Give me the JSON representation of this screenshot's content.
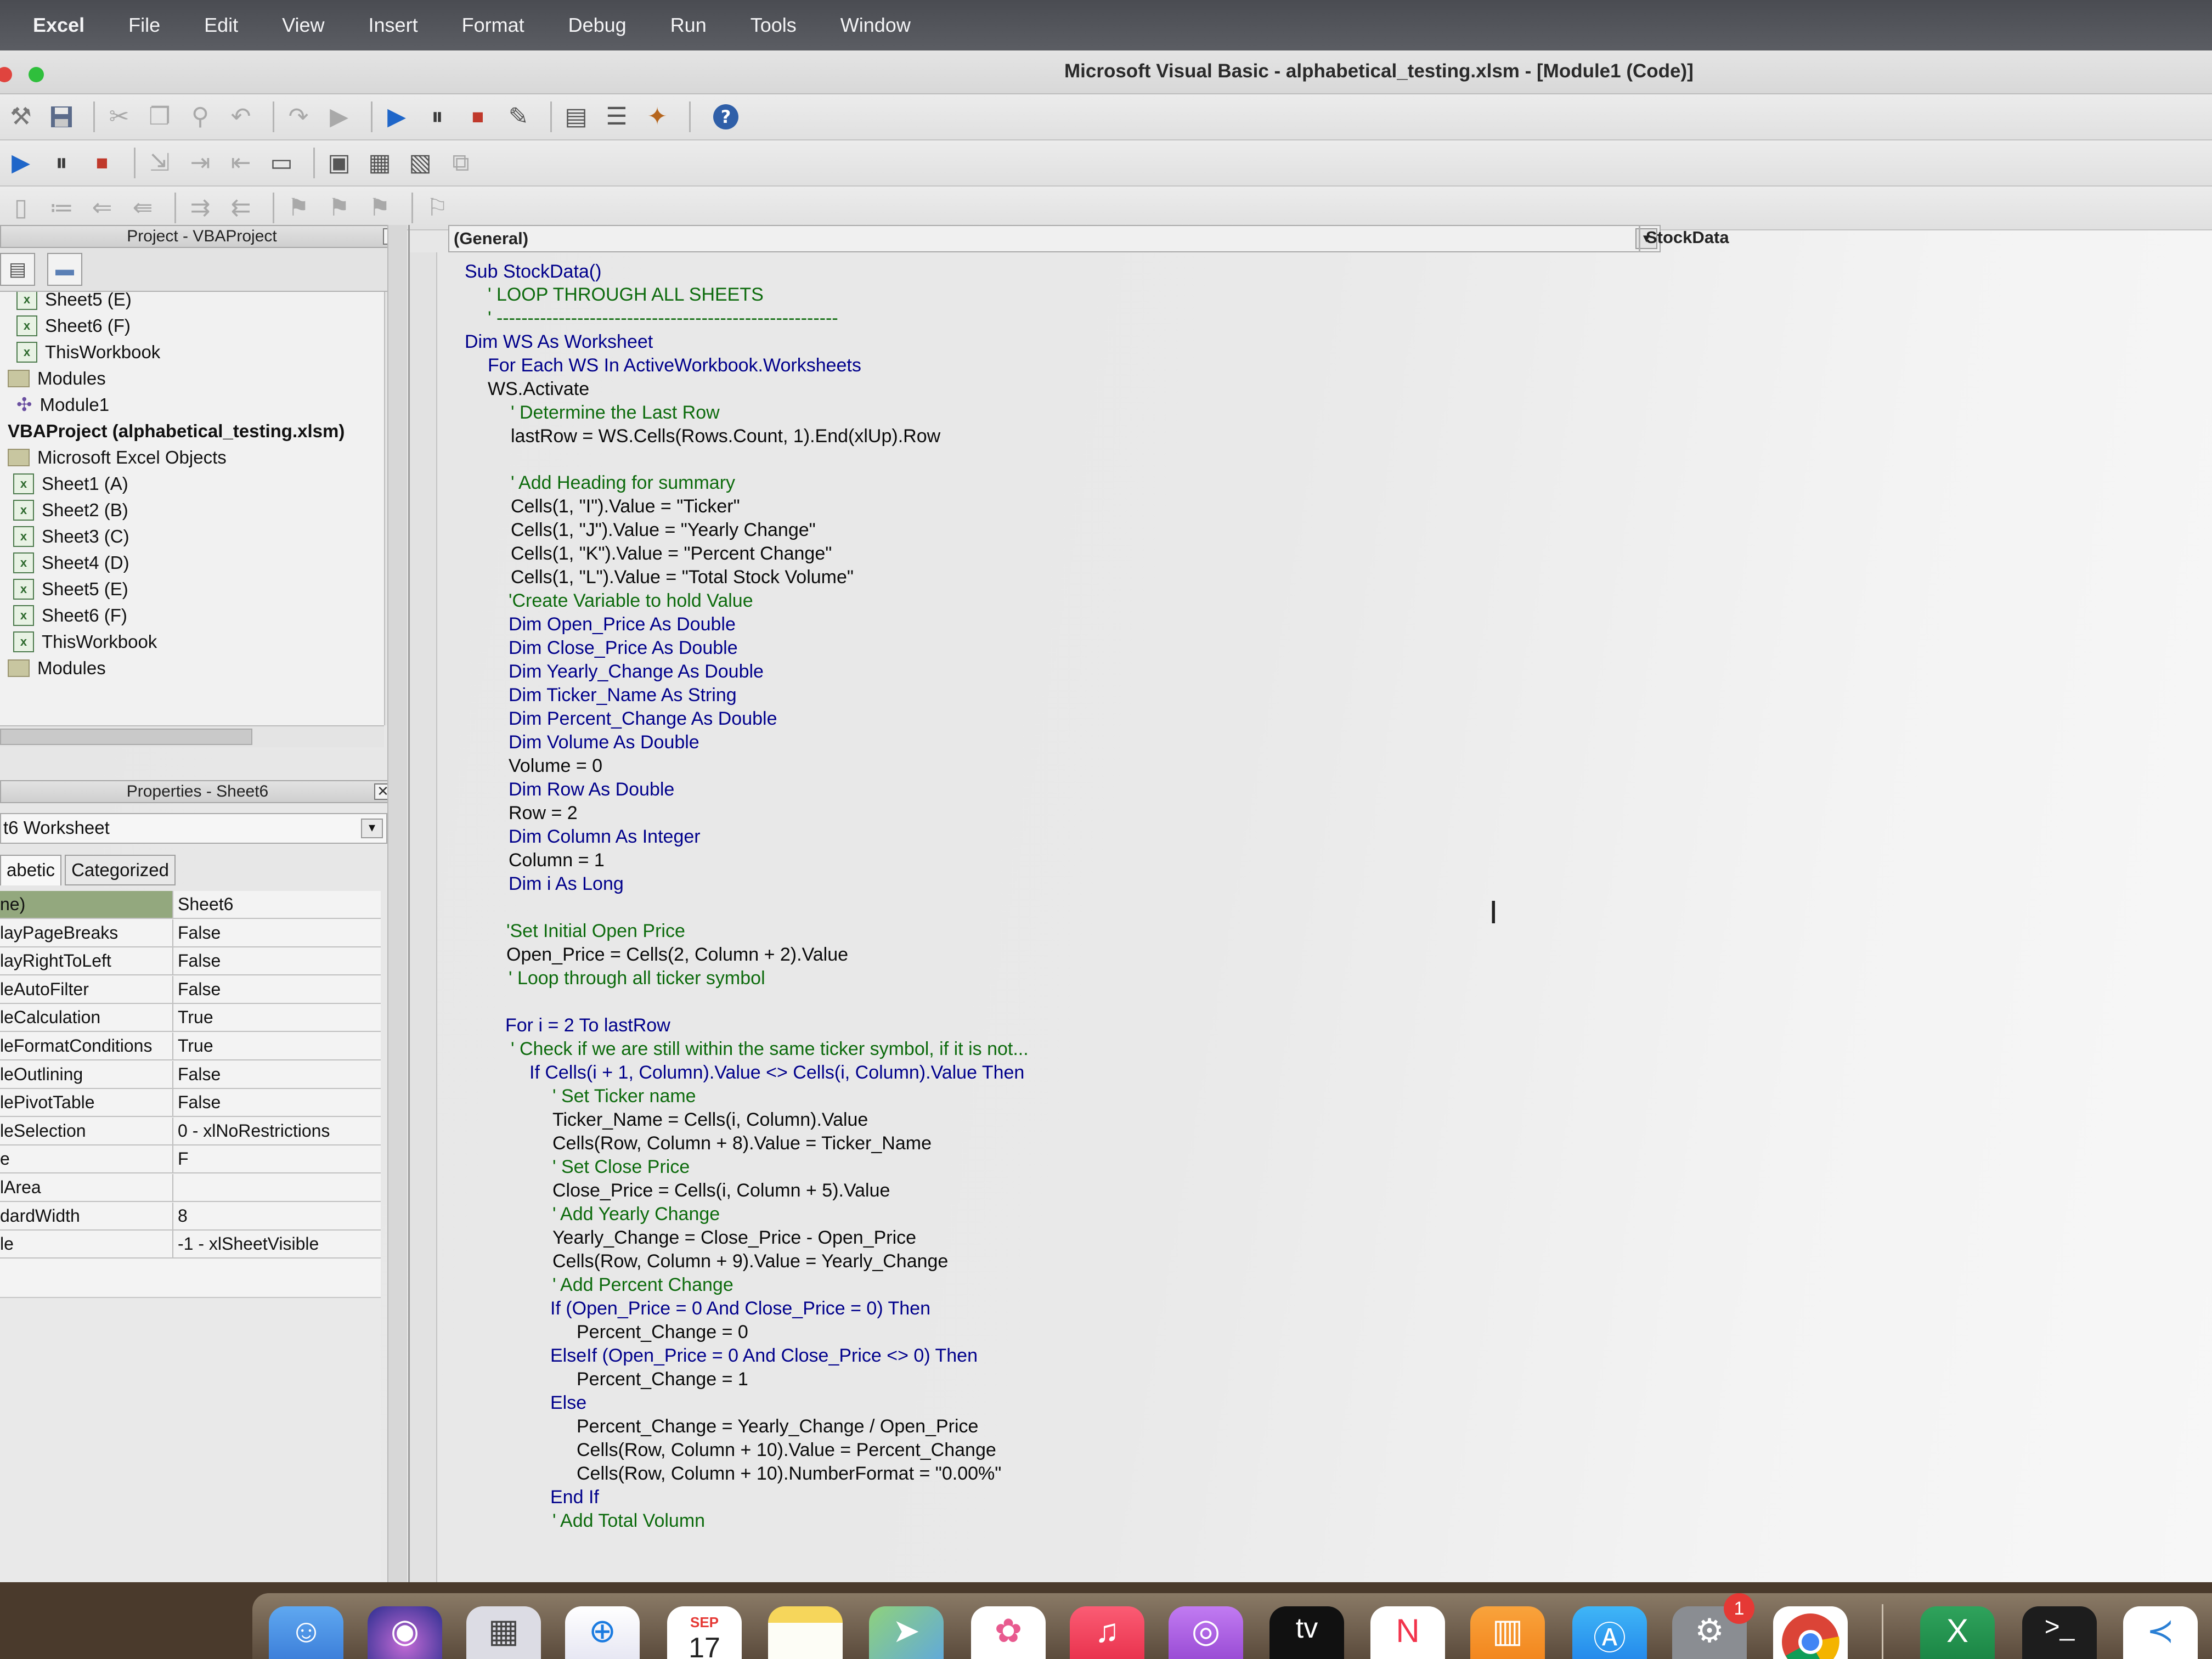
{
  "menubar": {
    "app": "Excel",
    "items": [
      "File",
      "Edit",
      "View",
      "Insert",
      "Format",
      "Debug",
      "Run",
      "Tools",
      "Window"
    ]
  },
  "window": {
    "title": "Microsoft Visual Basic - alphabetical_testing.xlsm - [Module1 (Code)]"
  },
  "toolbar": {
    "icons": [
      "excel-view-icon",
      "save-icon",
      "cut-icon",
      "copy-icon",
      "find-icon",
      "undo-icon",
      "redo-icon",
      "run-icon",
      "break-icon",
      "reset-icon",
      "design-mode-icon",
      "project-explorer-icon",
      "properties-window-icon",
      "object-browser-icon",
      "help-icon"
    ]
  },
  "project": {
    "header": "Project - VBAProject",
    "tree": [
      {
        "label": "Sheet5 (E)",
        "icon": "sheet"
      },
      {
        "label": "Sheet6 (F)",
        "icon": "sheet"
      },
      {
        "label": "ThisWorkbook",
        "icon": "sheet"
      },
      {
        "label": "Modules",
        "icon": "folder"
      },
      {
        "label": "Module1",
        "icon": "module"
      },
      {
        "label": "VBAProject (alphabetical_testing.xlsm)",
        "icon": "none"
      },
      {
        "label": "Microsoft Excel Objects",
        "icon": "folder"
      },
      {
        "label": "Sheet1 (A)",
        "icon": "sheet"
      },
      {
        "label": "Sheet2 (B)",
        "icon": "sheet"
      },
      {
        "label": "Sheet3 (C)",
        "icon": "sheet"
      },
      {
        "label": "Sheet4 (D)",
        "icon": "sheet"
      },
      {
        "label": "Sheet5 (E)",
        "icon": "sheet"
      },
      {
        "label": "Sheet6 (F)",
        "icon": "sheet"
      },
      {
        "label": "ThisWorkbook",
        "icon": "sheet"
      },
      {
        "label": "Modules",
        "icon": "folder"
      }
    ]
  },
  "properties": {
    "header": "Properties - Sheet6",
    "object": "t6 Worksheet",
    "tabs": [
      "abetic",
      "Categorized"
    ],
    "rows": [
      {
        "key": "ne)",
        "value": "Sheet6"
      },
      {
        "key": "layPageBreaks",
        "value": "False"
      },
      {
        "key": "layRightToLeft",
        "value": "False"
      },
      {
        "key": "leAutoFilter",
        "value": "False"
      },
      {
        "key": "leCalculation",
        "value": "True"
      },
      {
        "key": "leFormatConditions",
        "value": "True"
      },
      {
        "key": "leOutlining",
        "value": "False"
      },
      {
        "key": "lePivotTable",
        "value": "False"
      },
      {
        "key": "leSelection",
        "value": "0 - xlNoRestrictions"
      },
      {
        "key": "e",
        "value": "F"
      },
      {
        "key": "lArea",
        "value": ""
      },
      {
        "key": "dardWidth",
        "value": "8"
      },
      {
        "key": "le",
        "value": "-1 - xlSheetVisible"
      }
    ]
  },
  "code": {
    "object_combo": "(General)",
    "proc_combo": "StockData",
    "lines": [
      "Sub StockData()",
      "' LOOP THROUGH ALL SHEETS",
      "' -------------------------------------------------------",
      "Dim WS As Worksheet",
      "For Each WS In ActiveWorkbook.Worksheets",
      "WS.Activate",
      "' Determine the Last Row",
      "lastRow = WS.Cells(Rows.Count, 1).End(xlUp).Row",
      "",
      "' Add Heading for summary",
      "Cells(1, \"I\").Value = \"Ticker\"",
      "Cells(1, \"J\").Value = \"Yearly Change\"",
      "Cells(1, \"K\").Value = \"Percent Change\"",
      "Cells(1, \"L\").Value = \"Total Stock Volume\"",
      "'Create Variable to hold Value",
      "Dim Open_Price As Double",
      "Dim Close_Price As Double",
      "Dim Yearly_Change As Double",
      "Dim Ticker_Name As String",
      "Dim Percent_Change As Double",
      "Dim Volume As Double",
      "Volume = 0",
      "Dim Row As Double",
      "Row = 2",
      "Dim Column As Integer",
      "Column = 1",
      "Dim i As Long",
      "",
      "'Set Initial Open Price",
      "Open_Price = Cells(2, Column + 2).Value",
      "' Loop through all ticker symbol",
      "",
      "For i = 2 To lastRow",
      "' Check if we are still within the same ticker symbol, if it is not...",
      "If Cells(i + 1, Column).Value <> Cells(i, Column).Value Then",
      "' Set Ticker name",
      "Ticker_Name = Cells(i, Column).Value",
      "Cells(Row, Column + 8).Value = Ticker_Name",
      "' Set Close Price",
      "Close_Price = Cells(i, Column + 5).Value",
      "' Add Yearly Change",
      "Yearly_Change = Close_Price - Open_Price",
      "Cells(Row, Column + 9).Value = Yearly_Change",
      "' Add Percent Change",
      "If (Open_Price = 0 And Close_Price = 0) Then",
      "Percent_Change = 0",
      "ElseIf (Open_Price = 0 And Close_Price <> 0) Then",
      "Percent_Change = 1",
      "Else",
      "Percent_Change = Yearly_Change / Open_Price",
      "Cells(Row, Column + 10).Value = Percent_Change",
      "Cells(Row, Column + 10).NumberFormat = \"0.00%\"",
      "End If",
      "' Add Total Volumn"
    ]
  },
  "dock": {
    "apps": [
      "finder-icon",
      "siri-icon",
      "launchpad-icon",
      "safari-icon",
      "calendar-icon",
      "notes-icon",
      "maps-icon",
      "photos-icon",
      "music-icon",
      "podcasts-icon",
      "tv-icon",
      "news-icon",
      "books-icon",
      "app-store-icon",
      "system-preferences-icon",
      "chrome-icon",
      "excel-icon",
      "terminal-icon",
      "vscode-icon"
    ],
    "calendar_month": "SEP",
    "calendar_day": "17",
    "tv_label": "tv",
    "settings_badge": "1"
  }
}
